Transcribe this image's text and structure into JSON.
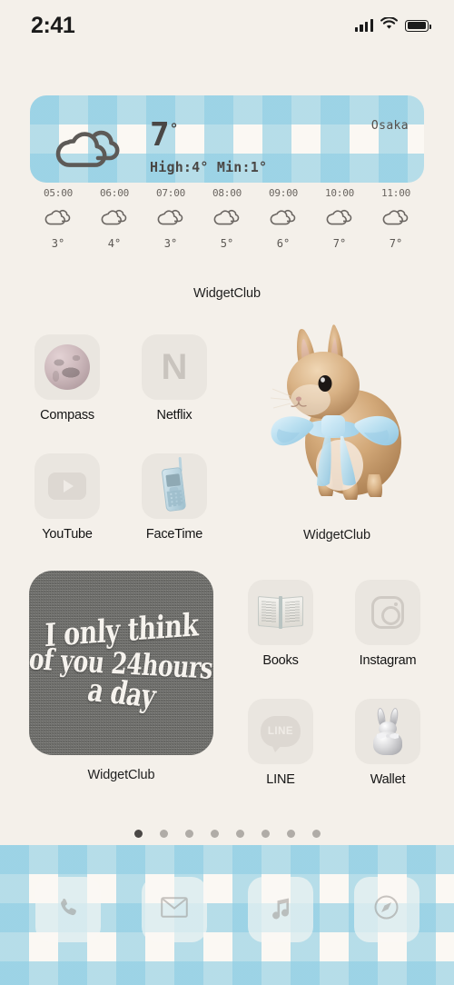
{
  "status_bar": {
    "time": "2:41",
    "signal_icon": "cellular-signal-icon",
    "wifi_icon": "wifi-icon",
    "battery_icon": "battery-icon"
  },
  "weather_widget": {
    "city": "Osaka",
    "condition_icon": "cloudy-icon",
    "temperature": "7",
    "degree": "°",
    "high_low": "High:4° Min:1°",
    "caption": "WidgetClub",
    "hourly": [
      {
        "time": "05:00",
        "icon": "cloudy-icon",
        "temp": "3°"
      },
      {
        "time": "06:00",
        "icon": "cloudy-icon",
        "temp": "4°"
      },
      {
        "time": "07:00",
        "icon": "cloudy-icon",
        "temp": "3°"
      },
      {
        "time": "08:00",
        "icon": "cloudy-icon",
        "temp": "5°"
      },
      {
        "time": "09:00",
        "icon": "cloudy-icon",
        "temp": "6°"
      },
      {
        "time": "10:00",
        "icon": "cloudy-icon",
        "temp": "7°"
      },
      {
        "time": "11:00",
        "icon": "cloudy-icon",
        "temp": "7°"
      }
    ]
  },
  "apps": {
    "compass": {
      "label": "Compass",
      "icon": "compass-sphere-icon"
    },
    "netflix": {
      "label": "Netflix",
      "icon": "netflix-n-icon",
      "glyph": "N"
    },
    "youtube": {
      "label": "YouTube",
      "icon": "youtube-play-icon"
    },
    "facetime": {
      "label": "FaceTime",
      "icon": "vintage-cellphone-icon"
    },
    "books": {
      "label": "Books",
      "icon": "open-book-icon"
    },
    "instagram": {
      "label": "Instagram",
      "icon": "instagram-camera-icon"
    },
    "line": {
      "label": "LINE",
      "icon": "line-speech-bubble-icon",
      "glyph": "LINE"
    },
    "wallet": {
      "label": "Wallet",
      "icon": "silver-bunny-icon"
    }
  },
  "bunny_widget": {
    "caption": "WidgetClub",
    "icon": "bunny-with-blue-bow-photo"
  },
  "quote_widget": {
    "caption": "WidgetClub",
    "line1": "I only think",
    "line2": "of you 24hours",
    "line3": "a day",
    "full_text": "I only think of you 24hours a day"
  },
  "page_dots": {
    "count": 8,
    "active_index": 0
  },
  "dock": {
    "items": [
      {
        "name": "Phone",
        "icon": "phone-handset-icon"
      },
      {
        "name": "Mail",
        "icon": "envelope-icon"
      },
      {
        "name": "Music",
        "icon": "music-note-icon"
      },
      {
        "name": "Safari",
        "icon": "compass-needle-icon"
      }
    ]
  },
  "theme": {
    "background": "#f4f0ea",
    "gingham_blue": "#8dcde3",
    "gingham_cream": "#fbf8f3",
    "icon_tile": "#eae6e0",
    "label_text": "#141414",
    "quote_bg": "#6f6f6b",
    "dot_active": "#4b4846",
    "dot_inactive": "#b0aca7"
  }
}
